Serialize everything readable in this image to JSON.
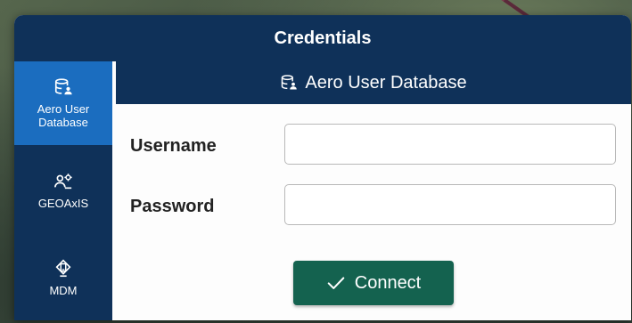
{
  "dialog": {
    "title": "Credentials"
  },
  "sidebar": {
    "items": [
      {
        "label": "Aero User\nDatabase",
        "icon": "database-user-icon",
        "active": true
      },
      {
        "label": "GEOAxIS",
        "icon": "users-gear-icon",
        "active": false
      },
      {
        "label": "MDM",
        "icon": "device-shield-icon",
        "active": false
      }
    ]
  },
  "main": {
    "header": {
      "title": "Aero User Database",
      "icon": "database-user-icon"
    },
    "fields": {
      "username": {
        "label": "Username",
        "value": "",
        "placeholder": ""
      },
      "password": {
        "label": "Password",
        "value": "",
        "placeholder": ""
      }
    },
    "connect_button": {
      "label": "Connect",
      "icon": "check-icon"
    }
  },
  "colors": {
    "navy": "#0f3159",
    "active_blue": "#1b6dbf",
    "connect_green": "#14624f"
  }
}
